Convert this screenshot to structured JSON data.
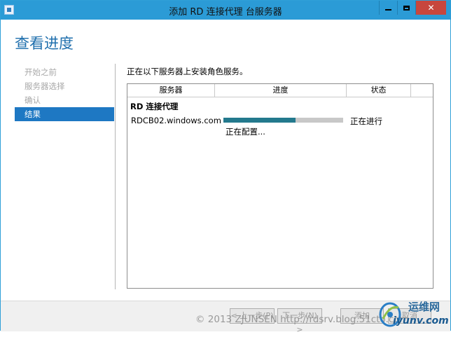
{
  "window": {
    "title": "添加 RD 连接代理 台服务器"
  },
  "page": {
    "heading": "查看进度"
  },
  "nav": {
    "items": [
      {
        "label": "开始之前",
        "active": false
      },
      {
        "label": "服务器选择",
        "active": false
      },
      {
        "label": "确认",
        "active": false
      },
      {
        "label": "结果",
        "active": true
      }
    ]
  },
  "main": {
    "instruction": "正在以下服务器上安装角色服务。",
    "columns": [
      "服务器",
      "进度",
      "状态"
    ],
    "group_label": "RD 连接代理",
    "row": {
      "server": "RDCB02.windows.com",
      "progress": 0.6,
      "status": "正在进行",
      "detail": "正在配置..."
    }
  },
  "footer": {
    "prev_label": "< 上一步(P)",
    "next_label": "下一步(N) >",
    "install_label": "添加",
    "cancel_label": "取消"
  },
  "watermark": {
    "text": "© 2013 ZJUNSEN http://rdsrv.blog.51cto.com",
    "logo_cn": "运维网",
    "logo_url": "iyunv.com"
  },
  "colors": {
    "accent": "#1e78c3",
    "titlebar": "#2b9bd6",
    "progress": "#23798d",
    "heading": "#1f6fad"
  }
}
